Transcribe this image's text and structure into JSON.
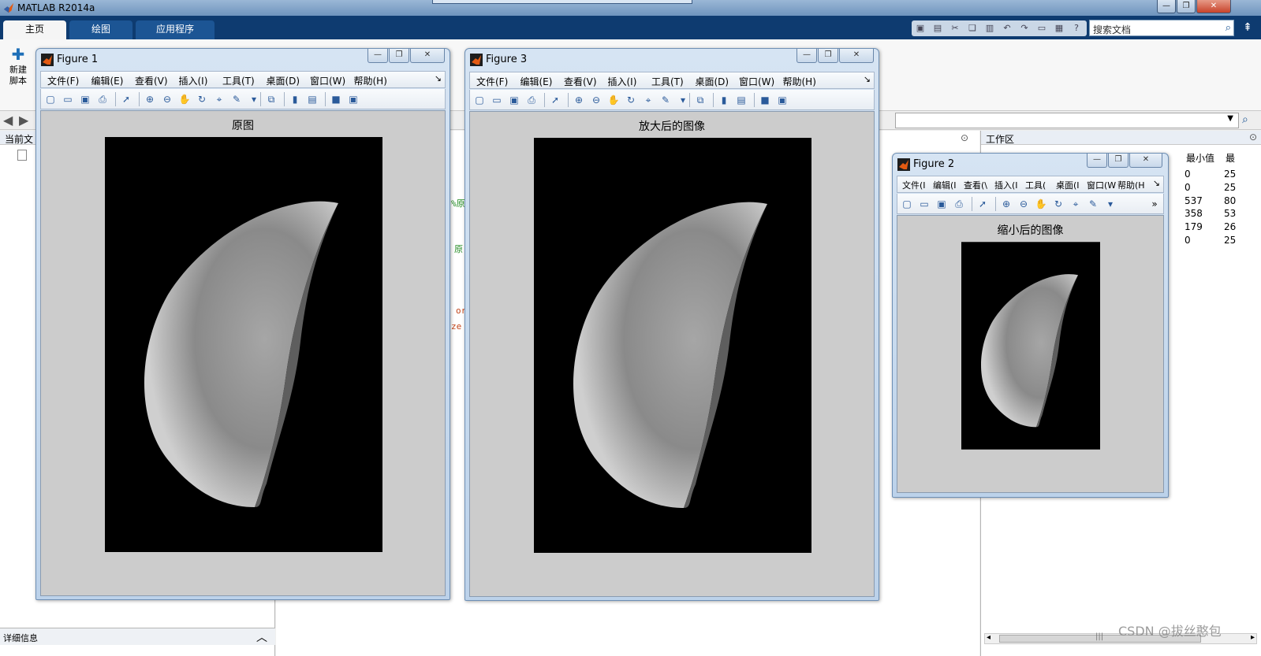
{
  "app": {
    "title": "MATLAB R2014a",
    "tabs": [
      "主页",
      "绘图",
      "应用程序"
    ],
    "search_placeholder": "搜索文档",
    "new_script_label": [
      "新建",
      "脚本"
    ],
    "minimize": "—",
    "maximize": "❐",
    "close": "✕"
  },
  "current_folder": {
    "header": "当前文",
    "details_label": "详细信息"
  },
  "editor": {
    "fragments": [
      "%原",
      "原",
      "or",
      "ze"
    ]
  },
  "workspace": {
    "header": "工作区",
    "columns": [
      "最小值",
      "最"
    ],
    "rows": [
      {
        "min": "0",
        "max": "25"
      },
      {
        "min": "0",
        "max": "25"
      },
      {
        "min": "537",
        "max": "80"
      },
      {
        "min": "358",
        "max": "53"
      },
      {
        "min": "179",
        "max": "26"
      },
      {
        "min": "0",
        "max": "25"
      }
    ]
  },
  "figures": {
    "fig1": {
      "title": "Figure 1",
      "axes_title": "原图",
      "menus": [
        "文件(F)",
        "编辑(E)",
        "查看(V)",
        "插入(I)",
        "工具(T)",
        "桌面(D)",
        "窗口(W)",
        "帮助(H)"
      ]
    },
    "fig3": {
      "title": "Figure 3",
      "axes_title": "放大后的图像",
      "menus": [
        "文件(F)",
        "编辑(E)",
        "查看(V)",
        "插入(I)",
        "工具(T)",
        "桌面(D)",
        "窗口(W)",
        "帮助(H)"
      ]
    },
    "fig2": {
      "title": "Figure 2",
      "axes_title": "缩小后的图像",
      "menus": [
        "文件(I",
        "编辑(I",
        "查看(\\",
        "插入(I",
        "工具(",
        "桌面(I",
        "窗口(W",
        "帮助(H"
      ]
    }
  },
  "watermark": "CSDN @拔丝憨包",
  "colors": {
    "ribbon": "#0e3b70",
    "figure_bg": "#cccccc",
    "image_bg": "#000000"
  }
}
